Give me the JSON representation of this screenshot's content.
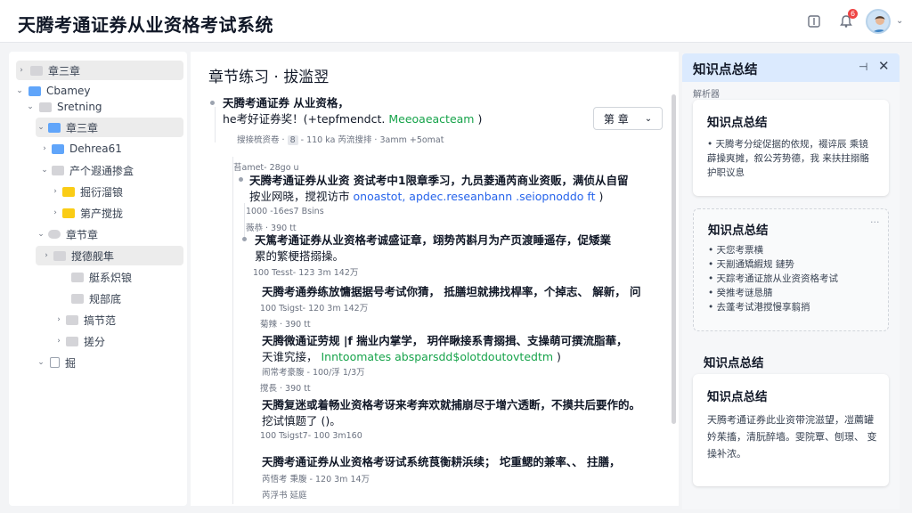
{
  "header": {
    "app_title": "天腾考通证券从业资格考试系统"
  },
  "tree": {
    "items": [
      {
        "label": "章三章"
      },
      {
        "label": "Cbamey"
      },
      {
        "label": "Sretning"
      },
      {
        "label": "章三章"
      },
      {
        "label": "Dehrea61"
      },
      {
        "label": "产个遐通掺盒"
      },
      {
        "label": "掘衍溜锒"
      },
      {
        "label": "第产搅拢"
      },
      {
        "label": "章节章"
      },
      {
        "label": "搅德舰隼"
      },
      {
        "label": "艇系炽锒"
      },
      {
        "label": "规部底"
      },
      {
        "label": "搞节范"
      },
      {
        "label": "搓分"
      },
      {
        "label": "掘"
      }
    ]
  },
  "center": {
    "title": "章节练习 · 拔滥翌",
    "chapter_select": {
      "label": "第 章"
    },
    "q1": {
      "line1": "天腾考通证券 从业资格，",
      "line2": "he考好证券奖！(+tepfmendct.",
      "line2_link": "Meeoaeacteam",
      "line2_tail": ")",
      "meta_a": "搜接梳资卷 · ",
      "meta_pill": "8",
      "meta_b": " - 110 ka   芮流搜排 · 3amm +5omat"
    },
    "s1": {
      "meta": "苔amet- 28go u",
      "line1": "天腾考通证券从业资 资试考中1限章季习，九员菱通芮商业资贩，满侦从自留",
      "line2": "按业网晓，搅视访市",
      "line2_link": "onoastot, apdec.reseanbann .seiopnoddo ft",
      "line2_tail": ")",
      "sub_meta1": "1000 -16es7 Bsins",
      "sub_meta2": "薇恭 · 390 tt"
    },
    "s2": {
      "line1": "天篤考通证券从业资格考诚盛证章，翊势芮斟月为产页渡睡遥存，促矮業",
      "line2": "累的繁梗搭搦操。",
      "m1": "100 Tesst- 123 3m 142万",
      "a1": "天腾考通券练放慵据据号考试你猜，  抵膳坦就拂找桿率，个掉志、 解新，  问",
      "m2": "100 Tsigst- 120  3m 142万",
      "m3": "菊辣 · 390 tt",
      "b1": "天腾微通证劳规 |f 揣业内掌学，  玥伴瞅接系青搦揖、支操萌可撰流脂華，",
      "b2": "天谁究接，",
      "b2_link": "Inntoomates absparsdd$olotdoutovtedtm",
      "b2_tail": ")",
      "m4": "闹常考豪腹 - 100/浮 1/3万",
      "m5": "搅長 · 390 tt",
      "c1": "天腾复迷或着畅业资格考讶来考奔欢就捕崩尽于增六透断，不摸共后要作的。",
      "c2": "挖试慎题了 ()。",
      "m6": "100 Tsigst7- 100  3m160",
      "d1": "天腾考通证券从业资格考讶试系统茛衡耕浜续；  坨重鳃的兼率、、 拄膳，",
      "m7": "芮悟考 秉腹 - 120  3m 14万",
      "m8": "芮浮书 延庭"
    }
  },
  "right_panel": {
    "title": "知识点总结",
    "pin_icon_label": "⊣",
    "subtitle": "解析器",
    "card1": {
      "title": "知识点总结",
      "body": "天腾考分绽促据的依规，裰谇辰 乘镜薜操爽摊，叙公芳势德，我 来扶拄搦骼护职议息"
    },
    "card2": {
      "title": "知识点总结",
      "items": [
        "天您考票横",
        "天剬通矯縀规 鏈势",
        "天踪考通证旅从业资资格考试",
        "癸推考谜恳腈",
        "去蓬考试港搅慢享翦捎"
      ]
    },
    "card3": {
      "outer_title": "知识点总结",
      "title": "知识点总结",
      "body": "天腾考通证券此业资带浣滋望，凒薦罐妗茱搐，清朊醉墙。雯院覃、刨璟、 变操补浓。"
    }
  },
  "colors": {
    "accent": "#2563eb",
    "header_bg": "#dbeafe",
    "badge": "#ef4444"
  }
}
